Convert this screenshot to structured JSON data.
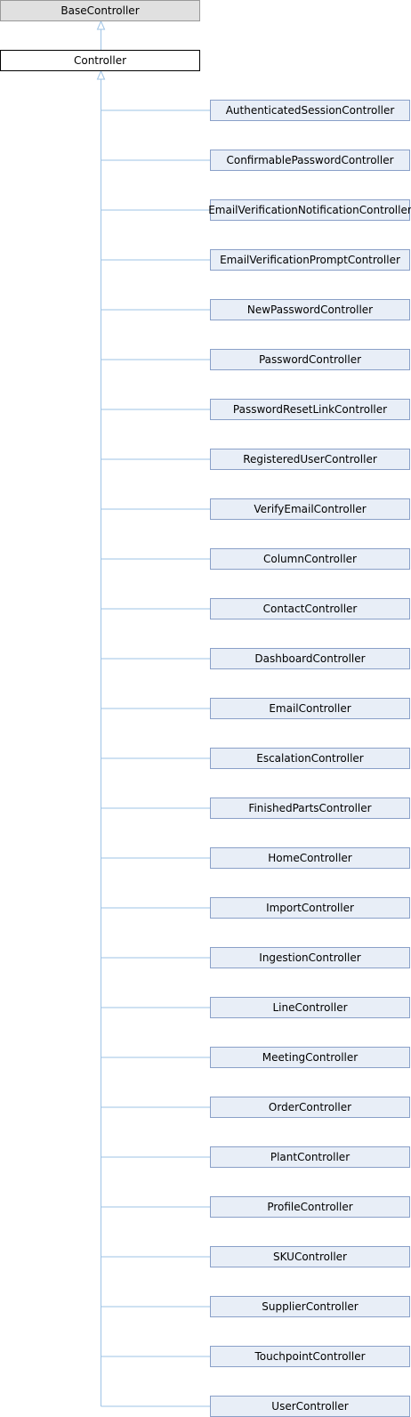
{
  "diagram": {
    "root": {
      "label": "BaseController",
      "fill": "#e0e0e0",
      "stroke": "#999999"
    },
    "parent": {
      "label": "Controller",
      "fill": "#ffffff",
      "stroke": "#000000"
    },
    "children": [
      "AuthenticatedSessionController",
      "ConfirmablePasswordController",
      "EmailVerificationNotificationController",
      "EmailVerificationPromptController",
      "NewPasswordController",
      "PasswordController",
      "PasswordResetLinkController",
      "RegisteredUserController",
      "VerifyEmailController",
      "ColumnController",
      "ContactController",
      "DashboardController",
      "EmailController",
      "EscalationController",
      "FinishedPartsController",
      "HomeController",
      "ImportController",
      "IngestionController",
      "LineController",
      "MeetingController",
      "OrderController",
      "PlantController",
      "ProfileController",
      "SKUController",
      "SupplierController",
      "TouchpointController",
      "UserController"
    ],
    "child_fill": "#e8eef7",
    "child_stroke": "#8aa0c8",
    "edge_color": "#9ec3e6"
  }
}
